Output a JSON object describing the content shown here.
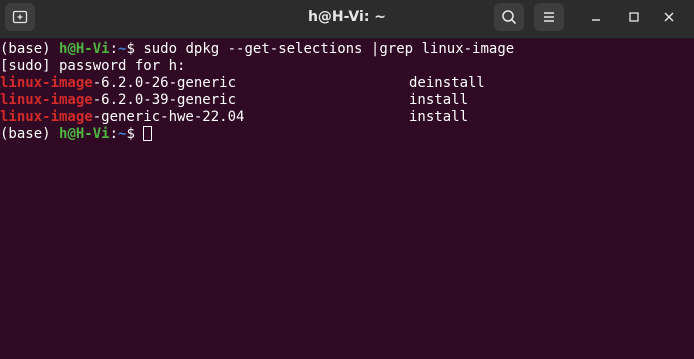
{
  "window": {
    "title": "h@H-Vi: ~"
  },
  "icons": {
    "new_tab": "new-tab-icon",
    "search": "search-icon",
    "menu": "hamburger-menu-icon",
    "minimize": "minimize-icon",
    "maximize": "maximize-icon",
    "close": "close-icon"
  },
  "colors": {
    "background": "#300a24",
    "user": "#4eb53f",
    "path": "#3f7fd6",
    "grep_match": "#d12a2a",
    "text": "#ffffff"
  },
  "terminal": {
    "prompt1": {
      "env": "(base) ",
      "user": "h@H-Vi",
      "colon": ":",
      "path": "~",
      "dollar": "$ ",
      "command": "sudo dpkg --get-selections |grep linux-image"
    },
    "sudo_prompt": "[sudo] password for h:",
    "rows": [
      {
        "match": "linux-image",
        "rest": "-6.2.0-26-generic",
        "status": "deinstall"
      },
      {
        "match": "linux-image",
        "rest": "-6.2.0-39-generic",
        "status": "install"
      },
      {
        "match": "linux-image",
        "rest": "-generic-hwe-22.04",
        "status": "install"
      }
    ],
    "prompt2": {
      "env": "(base) ",
      "user": "h@H-Vi",
      "colon": ":",
      "path": "~",
      "dollar": "$ "
    }
  }
}
